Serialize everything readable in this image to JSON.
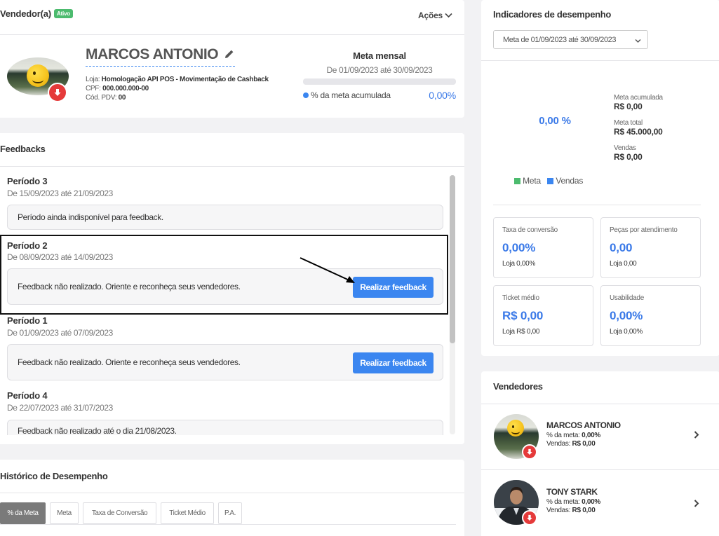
{
  "seller_card": {
    "title": "Vendedor(a)",
    "status_badge": "Ativo",
    "actions_label": "Ações",
    "name": "MARCOS ANTONIO",
    "store_label": "Loja:",
    "store_value": "Homologação API POS - Movimentação de Cashback",
    "cpf_label": "CPF:",
    "cpf_value": "000.000.000-00",
    "pdv_label": "Cód. PDV:",
    "pdv_value": "00",
    "goal_title": "Meta mensal",
    "goal_period": "De 01/09/2023 até 30/09/2023",
    "goal_progress_fraction": 0.0,
    "goal_legend": "% da meta acumulada",
    "goal_value": "0,00%"
  },
  "feedbacks": {
    "title": "Feedbacks",
    "periods": [
      {
        "name": "Período 3",
        "range": "De 15/09/2023 até 21/09/2023",
        "message": "Período ainda indisponível para feedback.",
        "button": null
      },
      {
        "name": "Período 2",
        "range": "De 08/09/2023 até 14/09/2023",
        "message": "Feedback não realizado. Oriente e reconheça seus vendedores.",
        "button": "Realizar feedback"
      },
      {
        "name": "Período 1",
        "range": "De 01/09/2023 até 07/09/2023",
        "message": "Feedback não realizado. Oriente e reconheça seus vendedores.",
        "button": "Realizar feedback"
      },
      {
        "name": "Período 4",
        "range": "De 22/07/2023 até 31/07/2023",
        "message": "Feedback não realizado até o dia 21/08/2023.",
        "button": null
      }
    ]
  },
  "history": {
    "title": "Histórico de Desempenho",
    "tabs": [
      "% da Meta",
      "Meta",
      "Taxa de Conversão",
      "Ticket Médio",
      "P.A."
    ],
    "active_tab": 0
  },
  "indicators": {
    "title": "Indicadores de desempenho",
    "period_select": "Meta de 01/09/2023 até 30/09/2023",
    "donut_value": "0,00 %",
    "accumulated_label": "Meta acumulada",
    "accumulated_value": "R$ 0,00",
    "total_label": "Meta total",
    "total_value": "R$ 45.000,00",
    "sales_label": "Vendas",
    "sales_value": "R$ 0,00",
    "legend": [
      {
        "label": "Meta",
        "color": "#4cbb6e"
      },
      {
        "label": "Vendas",
        "color": "#3b86f0"
      }
    ],
    "kpis": [
      {
        "label": "Taxa de conversão",
        "value": "0,00%",
        "sub": "Loja 0,00%"
      },
      {
        "label": "Peças por atendimento",
        "value": "0,00",
        "sub": "Loja 0,00"
      },
      {
        "label": "Ticket médio",
        "value": "R$ 0,00",
        "sub": "Loja R$ 0,00"
      },
      {
        "label": "Usabilidade",
        "value": "0,00%",
        "sub": "Loja 0,00%"
      }
    ]
  },
  "sellers": {
    "title": "Vendedores",
    "items": [
      {
        "name": "MARCOS ANTONIO",
        "goal_label": "% da meta:",
        "goal_value": "0,00%",
        "sales_label": "Vendas:",
        "sales_value": "R$ 0,00"
      },
      {
        "name": "TONY STARK",
        "goal_label": "% da meta:",
        "goal_value": "0,00%",
        "sales_label": "Vendas:",
        "sales_value": "R$ 0,00"
      }
    ]
  },
  "colors": {
    "accent": "#3b86f0",
    "success": "#4cbb6e",
    "danger": "#e53a3a"
  }
}
